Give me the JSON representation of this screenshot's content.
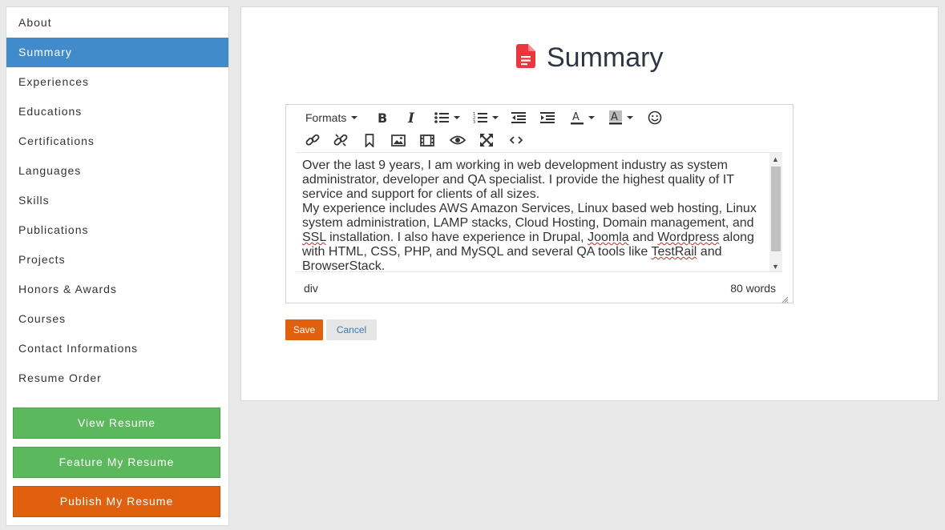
{
  "sidebar": {
    "items": [
      {
        "label": "About"
      },
      {
        "label": "Summary"
      },
      {
        "label": "Experiences"
      },
      {
        "label": "Educations"
      },
      {
        "label": "Certifications"
      },
      {
        "label": "Languages"
      },
      {
        "label": "Skills"
      },
      {
        "label": "Publications"
      },
      {
        "label": "Projects"
      },
      {
        "label": "Honors & Awards"
      },
      {
        "label": "Courses"
      },
      {
        "label": "Contact Informations"
      },
      {
        "label": "Resume Order"
      }
    ],
    "active_item": "Summary",
    "buttons": {
      "view_resume": "View Resume",
      "feature_resume": "Feature My Resume",
      "publish_resume": "Publish My Resume"
    }
  },
  "main": {
    "title": "Summary",
    "title_icon": "file-document-icon",
    "editor": {
      "toolbar": {
        "formats_label": "Formats",
        "row1_icons": [
          "bold-icon",
          "italic-icon",
          "bullet-list-icon",
          "numbered-list-icon",
          "outdent-icon",
          "indent-icon",
          "text-color-icon",
          "background-color-icon",
          "emoticons-icon"
        ],
        "row2_icons": [
          "link-icon",
          "unlink-icon",
          "bookmark-icon",
          "image-icon",
          "media-icon",
          "preview-icon",
          "fullscreen-icon",
          "source-code-icon"
        ]
      },
      "content": {
        "p1": "Over the last 9 years, I am working in web development industry as system administrator, developer and QA specialist. I provide the highest quality of IT service and support for clients of all sizes.",
        "p2_a": "My experience includes AWS Amazon Services, Linux based web hosting, Linux system administration, LAMP stacks, Cloud Hosting, Domain management, and ",
        "p2_ssl": "SSL",
        "p2_b": " installation. I also have experience in Drupal, ",
        "p2_joomla": "Joomla",
        "p2_c": " and ",
        "p2_wordpress": "Wordpress",
        "p2_d": " along with HTML, CSS, PHP, and MySQL and several QA tools like ",
        "p2_testrail": "TestRail",
        "p2_e": " and ",
        "p2_browserstack": "BrowserStack",
        "p2_f": "."
      },
      "status": {
        "path": "div",
        "word_count": "80 words"
      }
    },
    "buttons": {
      "save": "Save",
      "cancel": "Cancel"
    }
  },
  "colors": {
    "active_nav": "#428bca",
    "green_button": "#5cb85c",
    "orange_button": "#e0600f",
    "title_icon": "#e8383d",
    "cancel_link": "#337ab7"
  }
}
